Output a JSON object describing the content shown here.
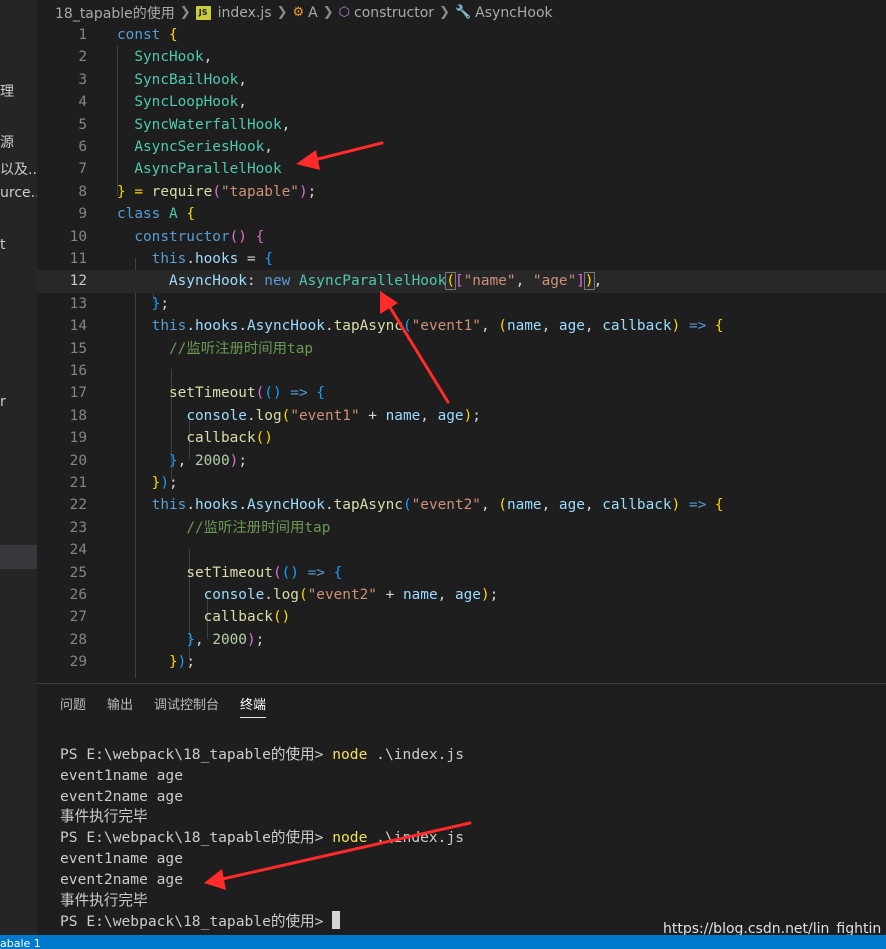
{
  "sidebar": {
    "items": [
      "理",
      "源",
      "以及...",
      "urce...",
      "t",
      "r"
    ]
  },
  "breadcrumb": {
    "folder": "18_tapable的使用",
    "file_badge": "JS",
    "file": "index.js",
    "class": "A",
    "method": "constructor",
    "property": "AsyncHook"
  },
  "editor": {
    "line_numbers": [
      "1",
      "2",
      "3",
      "4",
      "5",
      "6",
      "7",
      "8",
      "9",
      "10",
      "11",
      "12",
      "13",
      "14",
      "15",
      "16",
      "17",
      "18",
      "19",
      "20",
      "21",
      "22",
      "23",
      "24",
      "25",
      "26",
      "27",
      "28",
      "29"
    ],
    "current_line": "12",
    "code": {
      "const": "const",
      "brace_open": "{",
      "hooks": [
        "SyncHook",
        "SyncBailHook",
        "SyncLoopHook",
        "SyncWaterfallHook",
        "AsyncSeriesHook",
        "AsyncParallelHook"
      ],
      "comma": ",",
      "close_require_a": "} = ",
      "require": "require",
      "tapable_str": "\"tapable\"",
      "class_kw": "class",
      "class_name": "A",
      "constructor": "constructor",
      "this_kw": "this",
      "hooks_prop": "hooks",
      "asynchook": "AsyncHook",
      "new_kw": "new",
      "name_str": "\"name\"",
      "age_str": "\"age\"",
      "tapAsync": "tapAsync",
      "event1_str": "\"event1\"",
      "event2_str": "\"event2\"",
      "name_param": "name",
      "age_param": "age",
      "callback_param": "callback",
      "arrow": "=>",
      "comment": "//监听注册时间用tap",
      "setTimeout": "setTimeout",
      "console": "console",
      "log": "log",
      "callback_fn": "callback",
      "delay": "2000"
    }
  },
  "panel": {
    "tabs": [
      "问题",
      "输出",
      "调试控制台",
      "终端"
    ],
    "active_tab": "终端"
  },
  "terminal": {
    "prompt": "PS E:\\webpack\\18_tapable的使用> ",
    "command": "node",
    "args": " .\\index.js",
    "output1": "event1name age",
    "output2": "event2name age",
    "done": "事件执行完毕"
  },
  "watermark": "https://blog.csdn.net/lin_fightin",
  "statusbar": {
    "text": "abale 1"
  },
  "colors": {
    "keyword": "#569cd6",
    "class": "#4ec9b0",
    "string": "#ce9178",
    "arrow_annotation": "#ff2a2a"
  }
}
